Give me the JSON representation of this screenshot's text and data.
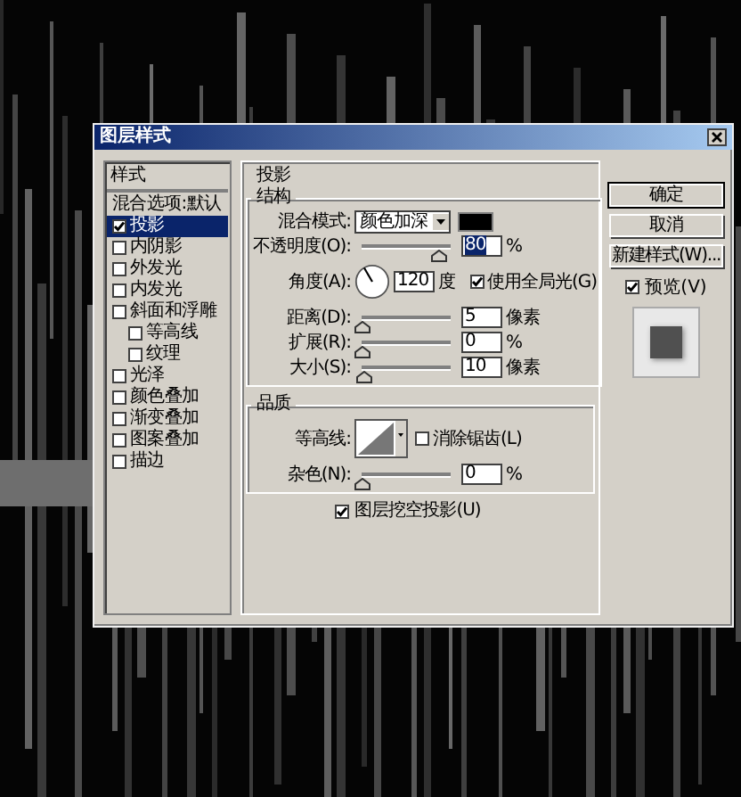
{
  "window": {
    "title": "图层样式"
  },
  "styles_panel": {
    "header": "样式",
    "items": [
      {
        "label": "混合选项:默认",
        "kind": "plain",
        "selected": false
      },
      {
        "label": "投影",
        "kind": "check",
        "checked": true,
        "selected": true
      },
      {
        "label": "内阴影",
        "kind": "check",
        "checked": false,
        "selected": false
      },
      {
        "label": "外发光",
        "kind": "check",
        "checked": false,
        "selected": false
      },
      {
        "label": "内发光",
        "kind": "check",
        "checked": false,
        "selected": false
      },
      {
        "label": "斜面和浮雕",
        "kind": "check",
        "checked": false,
        "selected": false,
        "children": [
          {
            "label": "等高线",
            "kind": "check",
            "checked": false,
            "selected": false
          },
          {
            "label": "纹理",
            "kind": "check",
            "checked": false,
            "selected": false
          }
        ]
      },
      {
        "label": "光泽",
        "kind": "check",
        "checked": false,
        "selected": false
      },
      {
        "label": "颜色叠加",
        "kind": "check",
        "checked": false,
        "selected": false
      },
      {
        "label": "渐变叠加",
        "kind": "check",
        "checked": false,
        "selected": false
      },
      {
        "label": "图案叠加",
        "kind": "check",
        "checked": false,
        "selected": false
      },
      {
        "label": "描边",
        "kind": "check",
        "checked": false,
        "selected": false
      }
    ]
  },
  "drop_shadow": {
    "title": "投影",
    "structure": {
      "title": "结构",
      "blend_mode": {
        "label": "混合模式:",
        "value": "颜色加深"
      },
      "rows": [
        {
          "kind": "slider",
          "label": "不透明度(O):",
          "level": 0.85,
          "value": "80",
          "focused": true,
          "unit": "%"
        },
        {
          "kind": "angle",
          "label": "角度(A):",
          "value": "120",
          "unit": "度",
          "option": {
            "label": "使用全局光(G)",
            "checked": true
          }
        },
        {
          "kind": "slider",
          "label": "距离(D):",
          "level": 0.0,
          "value": "5",
          "focused": false,
          "unit": "像素"
        },
        {
          "kind": "slider",
          "label": "扩展(R):",
          "level": 0.0,
          "value": "0",
          "focused": false,
          "unit": "%"
        },
        {
          "kind": "slider",
          "label": "大小(S):",
          "level": 0.02,
          "value": "10",
          "focused": false,
          "unit": "像素"
        }
      ]
    },
    "quality": {
      "title": "品质",
      "contour": {
        "label": "等高线:",
        "option": {
          "label": "消除锯齿(L)",
          "checked": false
        }
      },
      "noise": {
        "label": "杂色(N):",
        "level": 0.0,
        "value": "0",
        "focused": false,
        "unit": "%"
      }
    },
    "knockout": {
      "label": "图层挖空投影(U)",
      "checked": true
    }
  },
  "buttons": [
    "确定",
    "取消",
    "新建样式(W)..."
  ],
  "preview": {
    "label": "预览(V)",
    "checked": true
  }
}
